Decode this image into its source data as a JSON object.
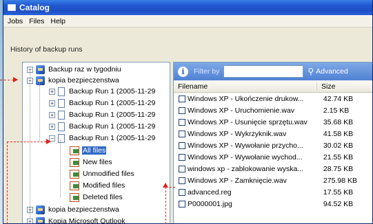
{
  "window": {
    "title": "Catalog"
  },
  "menu": [
    "Jobs",
    "Files",
    "Help"
  ],
  "section_label": "History of backup runs",
  "tree": [
    {
      "label": "Backup raz w tygodniu",
      "expander": "+",
      "icon": "database-icon"
    },
    {
      "label": "kopia bezpieczenstwa",
      "expander": "−",
      "icon": "database-icon"
    },
    {
      "label": "Backup Run 1 (2005-11-29",
      "expander": "+",
      "icon": "document-icon"
    },
    {
      "label": "Backup Run 1 (2005-11-29",
      "expander": "+",
      "icon": "document-icon"
    },
    {
      "label": "Backup Run 1 (2005-11-29",
      "expander": "+",
      "icon": "document-icon"
    },
    {
      "label": "Backup Run 1 (2005-11-29",
      "expander": "+",
      "icon": "document-icon"
    },
    {
      "label": "Backup Run 1 (2005-11-29",
      "expander": "−",
      "icon": "document-icon"
    },
    {
      "label": "All files",
      "icon": "filter-icon",
      "selected": true
    },
    {
      "label": "New files",
      "icon": "filter-icon"
    },
    {
      "label": "Unmodified files",
      "icon": "filter-icon"
    },
    {
      "label": "Modified files",
      "icon": "filter-icon"
    },
    {
      "label": "Deleted files",
      "icon": "filter-icon"
    },
    {
      "label": "kopia bezpieczenstwa",
      "expander": "+",
      "icon": "database-icon"
    },
    {
      "label": "Kopia Microsoft Outlook",
      "expander": "+",
      "icon": "database-icon"
    }
  ],
  "filter": {
    "label": "Filter by",
    "value": "",
    "advanced": "Advanced"
  },
  "columns": {
    "filename": "Filename",
    "size": "Size"
  },
  "files": [
    {
      "name": "Windows XP - Ukończenie drukow...",
      "size": "42.74 KB"
    },
    {
      "name": "Windows XP - Uruchomienie.wav",
      "size": "2.15 KB"
    },
    {
      "name": "Windows XP - Usunięcie sprzętu.wav",
      "size": "35.68 KB"
    },
    {
      "name": "Windows XP - Wykrzyknik.wav",
      "size": "41.58 KB"
    },
    {
      "name": "Windows XP - Wywołanie przycho...",
      "size": "30.02 KB"
    },
    {
      "name": "Windows XP - Wywołanie wychod...",
      "size": "21.55 KB"
    },
    {
      "name": "windows xp - zablokowanie wyska...",
      "size": "28.75 KB"
    },
    {
      "name": "Windows XP - Zamknięcie.wav",
      "size": "275.98 KB"
    },
    {
      "name": "advanced.reg",
      "size": "17.55 KB"
    },
    {
      "name": "P0000001.jpg",
      "size": "94.52 KB"
    }
  ],
  "colors": {
    "callout": "#e0201a",
    "selection": "#316ac5",
    "titlebar": "#2058d0"
  }
}
